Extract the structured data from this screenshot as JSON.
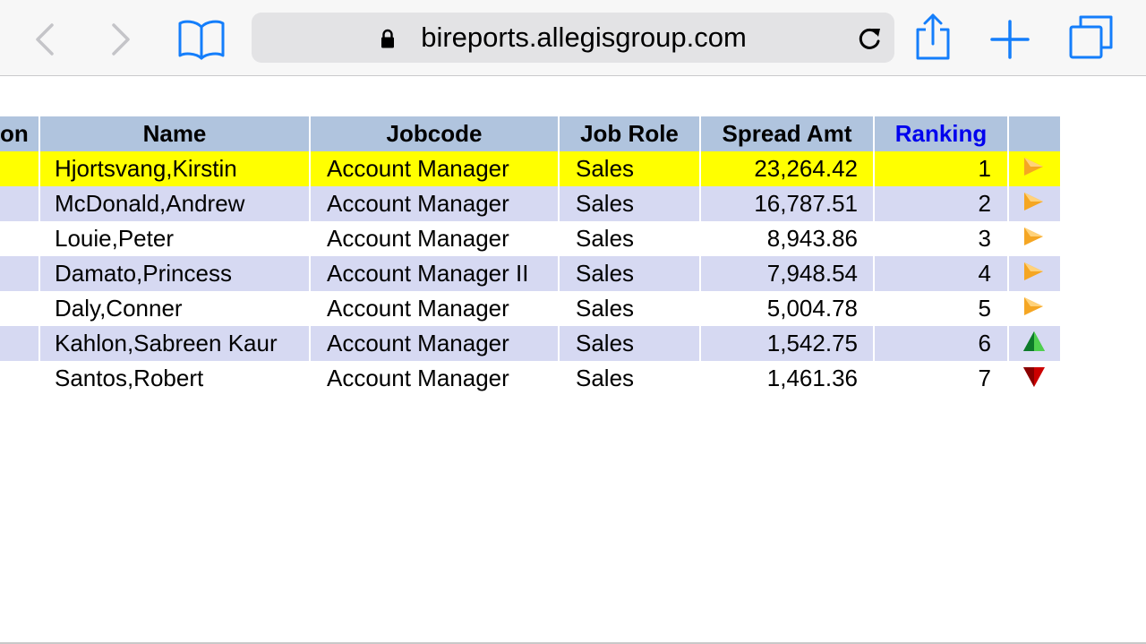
{
  "browser": {
    "url": "bireports.allegisgroup.com",
    "icons": [
      "back-icon",
      "forward-icon",
      "bookmarks-icon",
      "lock-icon",
      "reload-icon",
      "share-icon",
      "new-tab-icon",
      "tabs-icon"
    ]
  },
  "table": {
    "headers": {
      "col0": "on",
      "name": "Name",
      "jobcode": "Jobcode",
      "job_role": "Job Role",
      "spread_amt": "Spread Amt",
      "ranking": "Ranking"
    },
    "colors": {
      "header_bg": "#b0c4de",
      "highlight_row": "#ffff00",
      "band_row": "#d6d9f2",
      "ranking_header": "#0000ee",
      "trend_flat": "#f5a623",
      "trend_up": "#1aa31a",
      "trend_down": "#cc0000"
    },
    "rows": [
      {
        "name": "Hjortsvang,Kirstin",
        "jobcode": "Account Manager",
        "job_role": "Sales",
        "spread_amt": "23,264.42",
        "ranking": "1",
        "trend": "flat-arrow-icon"
      },
      {
        "name": "McDonald,Andrew",
        "jobcode": "Account Manager",
        "job_role": "Sales",
        "spread_amt": "16,787.51",
        "ranking": "2",
        "trend": "flat-arrow-icon"
      },
      {
        "name": "Louie,Peter",
        "jobcode": "Account Manager",
        "job_role": "Sales",
        "spread_amt": "8,943.86",
        "ranking": "3",
        "trend": "flat-arrow-icon"
      },
      {
        "name": "Damato,Princess",
        "jobcode": "Account Manager II",
        "job_role": "Sales",
        "spread_amt": "7,948.54",
        "ranking": "4",
        "trend": "flat-arrow-icon"
      },
      {
        "name": "Daly,Conner",
        "jobcode": "Account Manager",
        "job_role": "Sales",
        "spread_amt": "5,004.78",
        "ranking": "5",
        "trend": "flat-arrow-icon"
      },
      {
        "name": "Kahlon,Sabreen Kaur",
        "jobcode": "Account Manager",
        "job_role": "Sales",
        "spread_amt": "1,542.75",
        "ranking": "6",
        "trend": "up-arrow-icon"
      },
      {
        "name": "Santos,Robert",
        "jobcode": "Account Manager",
        "job_role": "Sales",
        "spread_amt": "1,461.36",
        "ranking": "7",
        "trend": "down-arrow-icon"
      }
    ]
  }
}
